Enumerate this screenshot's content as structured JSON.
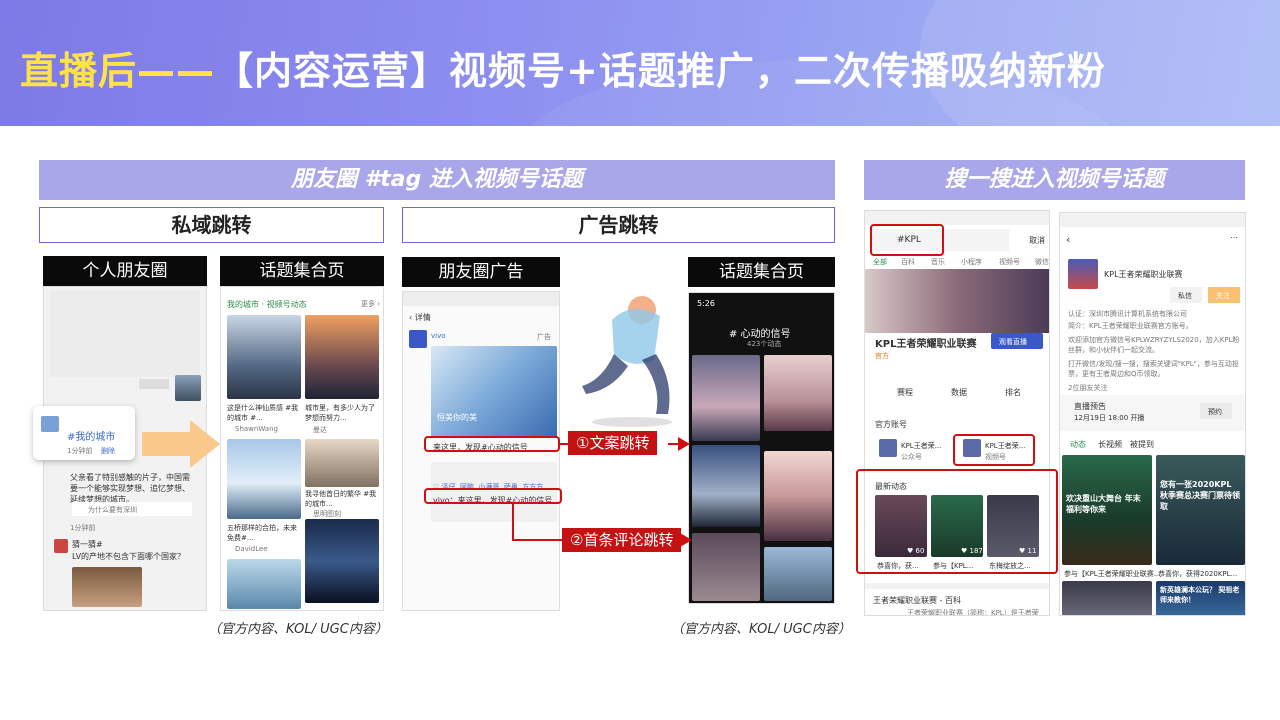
{
  "header": {
    "title_highlight": "直播后——",
    "title_rest": "【内容运营】视频号+话题推广，二次传播吸纳新粉"
  },
  "sections": {
    "moments_bar": "朋友圈 #tag 进入视频号话题",
    "search_bar": "搜一搜进入视频号话题",
    "private_box": "私域跳转",
    "ad_box": "广告跳转"
  },
  "panels": {
    "personal_moments": "个人朋友圈",
    "topic_collection_1": "话题集合页",
    "moments_ad": "朋友圈广告",
    "topic_collection_2": "话题集合页"
  },
  "captions": {
    "left": "（官方内容、KOL/ UGC内容）",
    "right": "（官方内容、KOL/ UGC内容）"
  },
  "labels": {
    "copy_jump": "①文案跳转",
    "comment_jump": "②首条评论跳转"
  },
  "phone1": {
    "tag": "#我的城市",
    "time": "1分钟前",
    "delete": "删除",
    "post": "父亲看了特别感触的片子，中国需要一个能够实现梦想、追忆梦想、延续梦想的城市。",
    "link": "为什么要有深圳",
    "time2": "1分钟前",
    "user2": "猜一猜#",
    "q2": "LV的产地不包含下面哪个国家？"
  },
  "phone2": {
    "header": "我的城市 · 视频号动态",
    "more": "更多 ›",
    "c1": "这是什么神仙质感 #我的城市 #...",
    "c1u": "ShawnWang",
    "c2": "城市里，有多少人为了梦想而努力...",
    "c2u": "曼达",
    "c3": "五桥那样的合拍，未来免费#...",
    "c3u": "DavidLee",
    "c4": "我寻他首日的繁华 #我的城市...",
    "c4u": "思明图刻"
  },
  "phone3": {
    "back": "‹  详情",
    "brand": "vivo",
    "ad": "广告",
    "cover": "恒美你的美",
    "copy": "来这里，发现#心动的信号",
    "likes": "♡ 泽仔, 阿鹏, 小满哥, 萨鼻, 方方方",
    "comment": "vivo：来这里，发现#心动的信号"
  },
  "phone4": {
    "time": "5:26",
    "topic": "# 心动的信号",
    "sub": "423个动态"
  },
  "phone5": {
    "search": "#KPL",
    "cancel": "取消",
    "tabs": [
      "全部",
      "百科",
      "音乐",
      "小程序",
      "视频号",
      "微信"
    ],
    "banner": "KPL王者荣耀职业联赛",
    "official": "官方",
    "live_btn": "观看直播",
    "icons": [
      "赛程",
      "数据",
      "排名"
    ],
    "official_accounts": "官方账号",
    "acc1": "KPL王者荣...",
    "acc1sub": "公众号",
    "acc2": "KPL王者荣...",
    "acc2sub": "视频号",
    "latest": "最新动态",
    "v1": "恭喜你，获...",
    "v2": "参与【KPL...",
    "v3": "东梅绽放之...",
    "v1n": "♥ 60",
    "v2n": "♥ 187",
    "v3n": "♥ 11",
    "footer": "王者荣耀职业联赛 - 百科",
    "footer2": "王者荣耀职业联赛（简称：KPL）是王者荣"
  },
  "phone6": {
    "name": "KPL王者荣耀职业联赛",
    "msg": "私信",
    "follow": "关注",
    "cert": "认证：深圳市腾讯计算机系统有限公司",
    "intro": "简介：KPL王者荣耀职业联赛官方账号。",
    "desc": "欢迎添加官方微信号KPLWZRYZYLS2020，加入KPL粉丝群，和小伙伴们一起交流。",
    "desc2": "打开微信/发现/搜一搜，搜索关键词\"KPL\"，参与互动投票，更有王者周边和Q币领取。",
    "friends": "2位朋友关注",
    "live": "直播预告",
    "live_time": "12月19日 18:00 开播",
    "reserve": "预约",
    "tabs": [
      "动态",
      "长视频",
      "被提到"
    ],
    "p1": "欢决重山大舞台 年末福利等你来",
    "p2": "您有一张2020KPL 秋季赛总决赛门票待领取",
    "c1": "参与【KPL王者荣耀职业联赛...",
    "c2": "恭喜你，获得2020KPL...",
    "p3": "新英雄澜本公玩？ 契祖老师来教你！"
  },
  "colors": {
    "banner": "#8b8ef0",
    "highlight": "#ffe24a",
    "bar": "#a9a6ea",
    "accent_red": "#c41212",
    "arrow": "#f9c88a"
  }
}
